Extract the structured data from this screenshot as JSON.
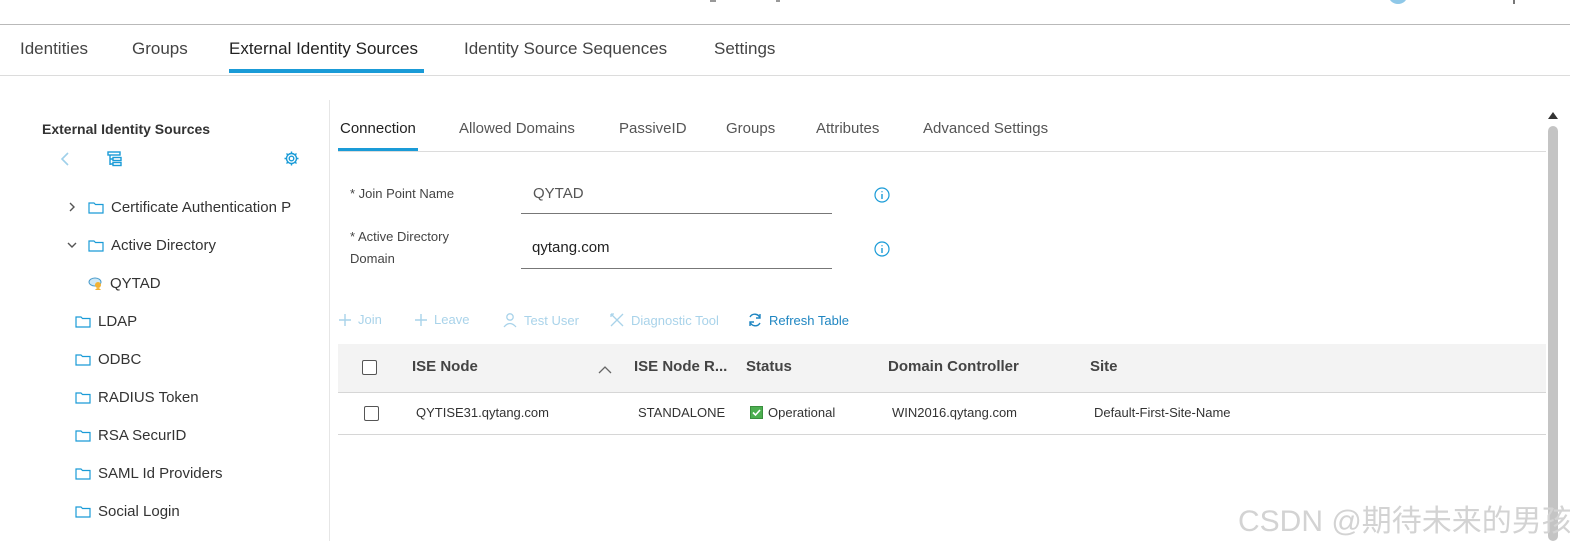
{
  "main_nav": {
    "tabs": [
      "Identities",
      "Groups",
      "External Identity Sources",
      "Identity Source Sequences",
      "Settings"
    ],
    "active": "External Identity Sources"
  },
  "left_panel": {
    "title": "External Identity Sources",
    "tree": [
      {
        "label": "Certificate Authentication P",
        "expanded": false
      },
      {
        "label": "Active Directory",
        "expanded": true
      },
      {
        "label": "QYTAD",
        "icon": "ad-server-icon"
      },
      {
        "label": "LDAP"
      },
      {
        "label": "ODBC"
      },
      {
        "label": "RADIUS Token"
      },
      {
        "label": "RSA SecurID"
      },
      {
        "label": "SAML Id Providers"
      },
      {
        "label": "Social Login"
      }
    ]
  },
  "sub_tabs": {
    "tabs": [
      "Connection",
      "Allowed Domains",
      "PassiveID",
      "Groups",
      "Attributes",
      "Advanced Settings"
    ],
    "active": "Connection"
  },
  "form": {
    "join_point": {
      "label": "* Join Point Name",
      "value": "QYTAD"
    },
    "ad_domain": {
      "label_line1": "* Active Directory",
      "label_line2": "Domain",
      "value": "qytang.com"
    }
  },
  "toolbar": {
    "join": "Join",
    "leave": "Leave",
    "test_user": "Test User",
    "diagnostic_tool": "Diagnostic Tool",
    "refresh_table": "Refresh Table"
  },
  "table": {
    "columns": [
      "ISE Node",
      "ISE Node R...",
      "Status",
      "Domain Controller",
      "Site"
    ],
    "rows": [
      {
        "node": "QYTISE31.qytang.com",
        "role": "STANDALONE",
        "status": "Operational",
        "dc": "WIN2016.qytang.com",
        "site": "Default-First-Site-Name"
      }
    ]
  },
  "watermark": "CSDN @期待未来的男孩",
  "colors": {
    "accent": "#1a9bd7",
    "link": "#1f86c2",
    "status_ok": "#4caf50"
  }
}
